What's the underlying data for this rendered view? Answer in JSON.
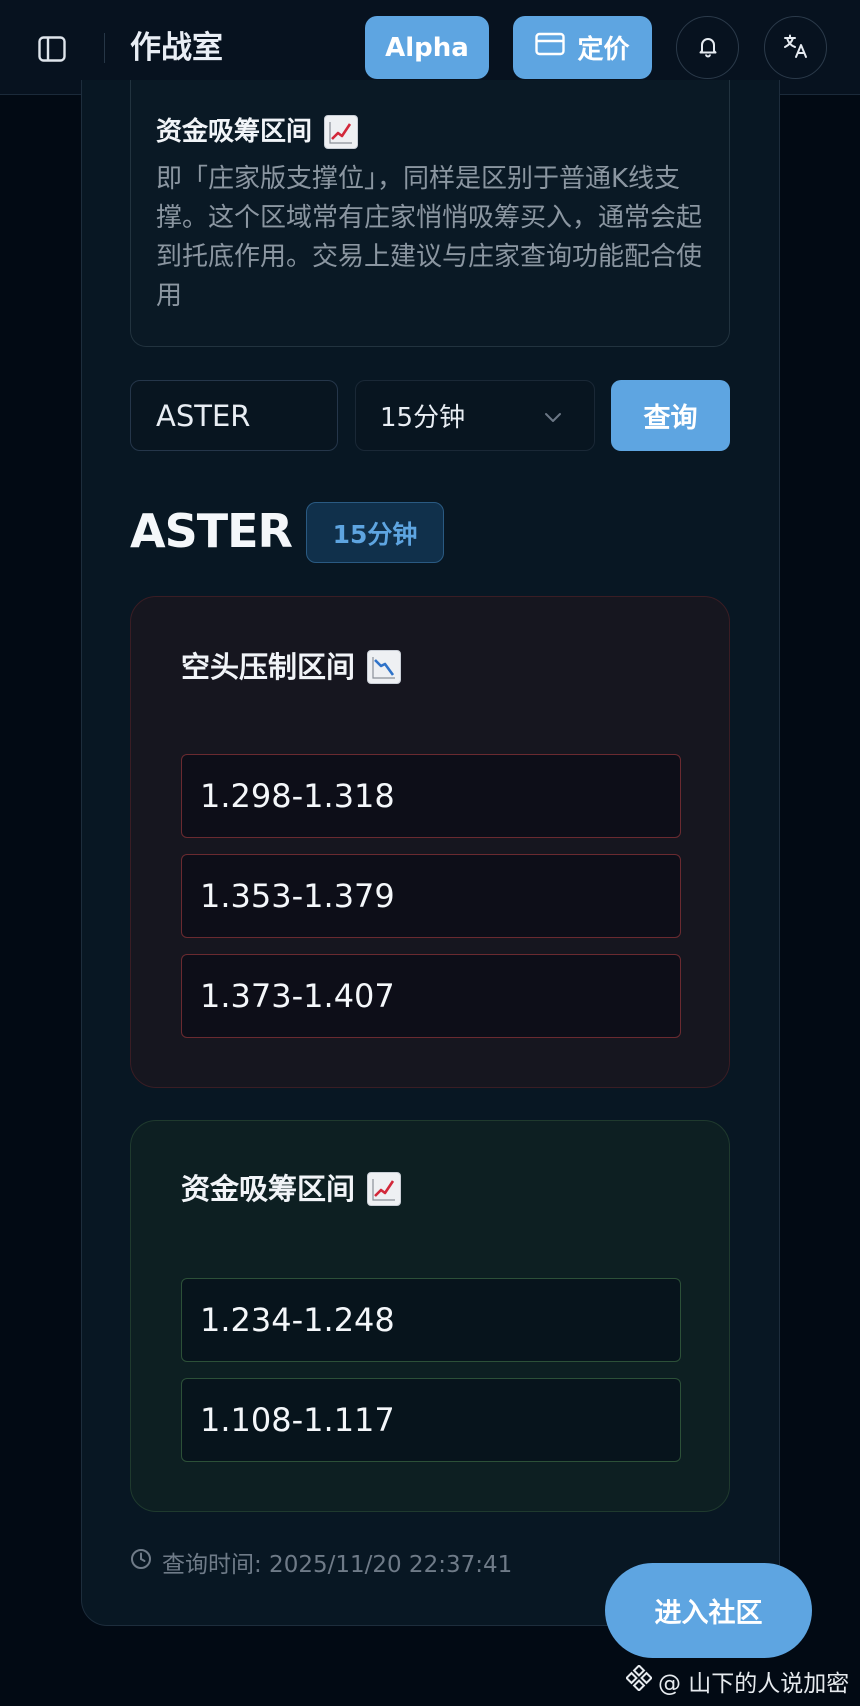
{
  "header": {
    "title": "作战室",
    "alpha_label": "Alpha",
    "pricing_label": "定价"
  },
  "info": {
    "title": "资金吸筹区间",
    "description": "即「庄家版支撑位」，同样是区别于普通K线支撑。这个区域常有庄家悄悄吸筹买入，通常会起到托底作用。交易上建议与庄家查询功能配合使用"
  },
  "query": {
    "symbol_value": "ASTER",
    "interval_value": "15分钟",
    "submit_label": "查询"
  },
  "result": {
    "symbol": "ASTER",
    "interval_badge": "15分钟",
    "bear_zone": {
      "title": "空头压制区间",
      "ranges": [
        "1.298-1.318",
        "1.353-1.379",
        "1.373-1.407"
      ]
    },
    "bull_zone": {
      "title": "资金吸筹区间",
      "ranges": [
        "1.234-1.248",
        "1.108-1.117"
      ]
    },
    "query_time": "查询时间: 2025/11/20 22:37:41"
  },
  "community_button": "进入社区",
  "watermark": "@ 山下的人说加密",
  "colors": {
    "accent": "#5ea5e1",
    "bear_border": "#6a2a30",
    "bull_border": "#2c5038",
    "background": "#020a14"
  }
}
